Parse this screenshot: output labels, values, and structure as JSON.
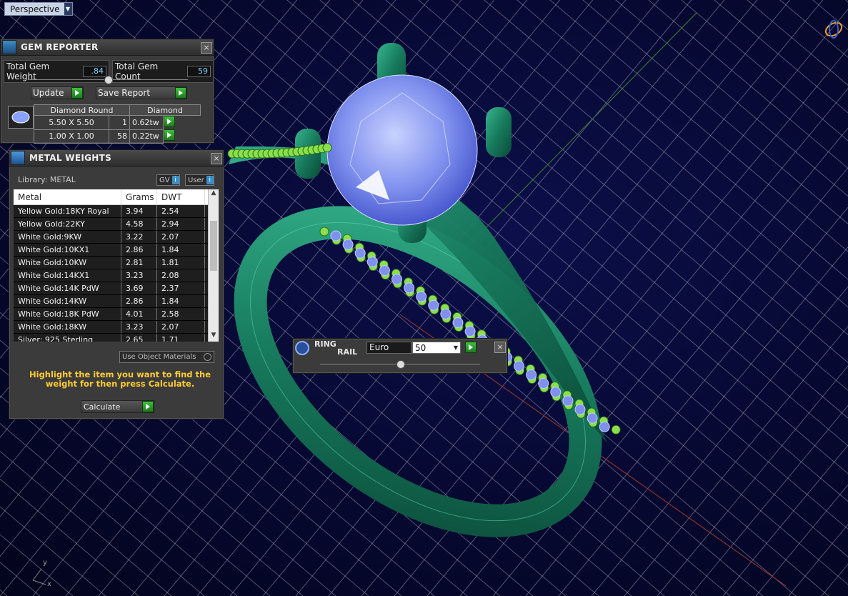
{
  "viewport": {
    "tab_label": "Perspective",
    "axis_y": "y",
    "axis_x": "x"
  },
  "colors": {
    "background": "#060830",
    "grid": "#c9c9d9",
    "ring_metal": "#1f8a6a",
    "accent_gems": "#8ae04a",
    "diamond": "#7f90ee"
  },
  "gem_reporter": {
    "title": "GEM REPORTER",
    "total_weight_label": "Total Gem Weight",
    "total_weight_value": ".84",
    "total_count_label": "Total Gem Count",
    "total_count_value": "59",
    "update_label": "Update",
    "save_label": "Save Report",
    "table_headers": [
      "Diamond Round",
      "Diamond"
    ],
    "rows": [
      {
        "size": "5.50 X 5.50",
        "count": "1",
        "weight": "0.62tw"
      },
      {
        "size": "1.00 X 1.00",
        "count": "58",
        "weight": "0.22tw"
      }
    ]
  },
  "metal_weights": {
    "title": "METAL WEIGHTS",
    "library_label": "Library: METAL",
    "gv_label": "GV",
    "user_label": "User",
    "columns": [
      "Metal",
      "Grams",
      "DWT"
    ],
    "rows": [
      {
        "metal": "Yellow Gold:18KY Royal",
        "grams": "3.94",
        "dwt": "2.54"
      },
      {
        "metal": "Yellow Gold:22KY",
        "grams": "4.58",
        "dwt": "2.94"
      },
      {
        "metal": "White Gold:9KW",
        "grams": "3.22",
        "dwt": "2.07"
      },
      {
        "metal": "White Gold:10KX1",
        "grams": "2.86",
        "dwt": "1.84"
      },
      {
        "metal": "White Gold:10KW",
        "grams": "2.81",
        "dwt": "1.81"
      },
      {
        "metal": "White Gold:14KX1",
        "grams": "3.23",
        "dwt": "2.08"
      },
      {
        "metal": "White Gold:14K PdW",
        "grams": "3.69",
        "dwt": "2.37"
      },
      {
        "metal": "White Gold:14KW",
        "grams": "2.86",
        "dwt": "1.84"
      },
      {
        "metal": "White Gold:18K PdW",
        "grams": "4.01",
        "dwt": "2.58"
      },
      {
        "metal": "White Gold:18KW",
        "grams": "3.23",
        "dwt": "2.07"
      },
      {
        "metal": "Silver:.925 Sterling",
        "grams": "2.65",
        "dwt": "1.71"
      }
    ],
    "use_object_label": "Use Object Materials",
    "instruction": "Highlight the item you want to find the weight for then press Calculate.",
    "calculate_label": "Calculate"
  },
  "ring_rail": {
    "title_line1": "RING",
    "title_line2": "RAIL",
    "standard": "Euro",
    "size": "50"
  }
}
